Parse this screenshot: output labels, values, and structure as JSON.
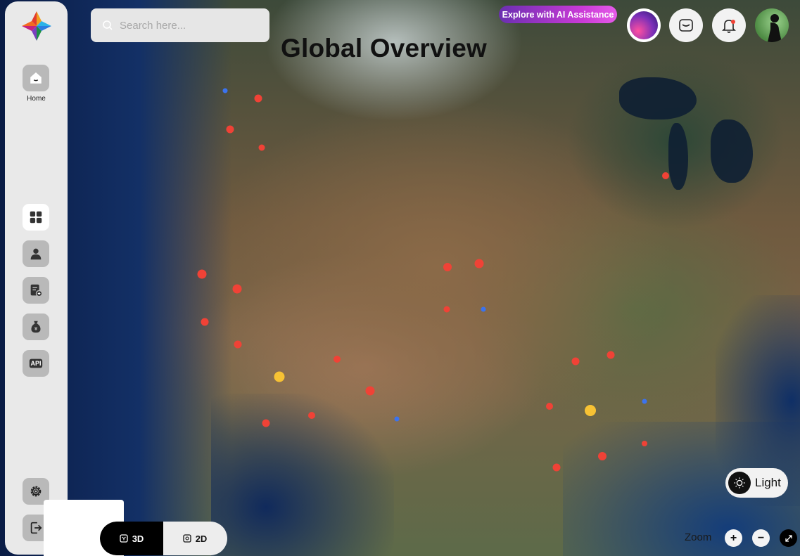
{
  "search": {
    "placeholder": "Search here..."
  },
  "page": {
    "title": "Global Overview"
  },
  "header": {
    "ai_button_label": "Explore with AI Assistance"
  },
  "sidebar": {
    "home_label": "Home",
    "items": [
      {
        "icon": "home-icon"
      },
      {
        "icon": "dashboard-icon"
      },
      {
        "icon": "user-icon"
      },
      {
        "icon": "document-add-icon"
      },
      {
        "icon": "money-bag-icon"
      },
      {
        "icon": "api-icon"
      },
      {
        "icon": "gear-icon"
      },
      {
        "icon": "logout-icon"
      }
    ],
    "api_label": "API"
  },
  "theme_toggle": {
    "label": "Light"
  },
  "view_toggle": {
    "options": [
      "3D",
      "2D"
    ],
    "selected": "3D"
  },
  "zoom": {
    "label": "Zoom",
    "in": "+",
    "out": "−"
  },
  "colors": {
    "marker_red": "#f04236",
    "marker_blue": "#3b73ef",
    "marker_yellow": "#f7c234",
    "ai_gradient_start": "#6a2fb0",
    "ai_gradient_end": "#e65be9"
  }
}
